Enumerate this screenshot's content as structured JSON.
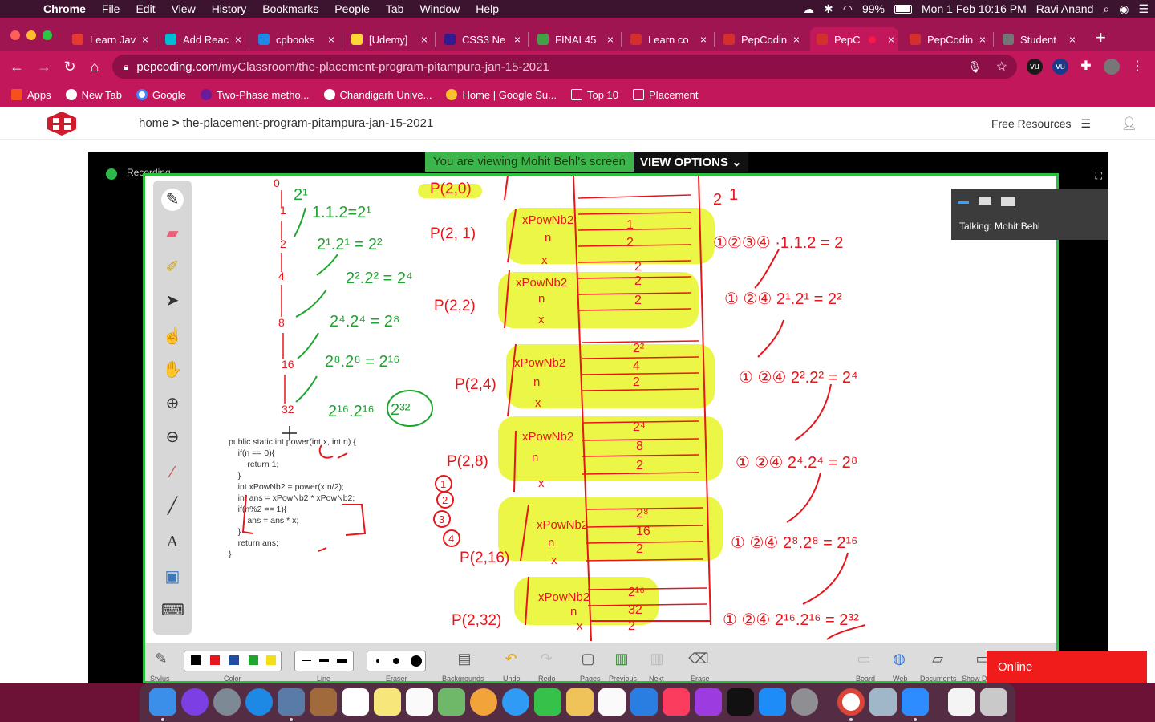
{
  "menubar": {
    "app": "Chrome",
    "items": [
      "File",
      "Edit",
      "View",
      "History",
      "Bookmarks",
      "People",
      "Tab",
      "Window",
      "Help"
    ],
    "battery": "99%",
    "datetime": "Mon 1 Feb  10:16 PM",
    "user": "Ravi Anand"
  },
  "tabs": [
    {
      "label": "Learn Jav",
      "color": "#e53935"
    },
    {
      "label": "Add Reac",
      "color": "#00bcd4"
    },
    {
      "label": "cpbooks",
      "color": "#1e88e5"
    },
    {
      "label": "[Udemy]",
      "color": "#fdd835"
    },
    {
      "label": "CSS3 Ne",
      "color": "#311b92"
    },
    {
      "label": "FINAL45",
      "color": "#43a047"
    },
    {
      "label": "Learn co",
      "color": "#d32f2f"
    },
    {
      "label": "PepCodin",
      "color": "#d32f2f"
    },
    {
      "label": "PepC",
      "color": "#d32f2f"
    },
    {
      "label": "PepCodin",
      "color": "#d32f2f"
    },
    {
      "label": "Student",
      "color": "#757575"
    }
  ],
  "omnibox": {
    "host": "pepcoding.com",
    "path": "/myClassroom/the-placement-program-pitampura-jan-15-2021"
  },
  "bookmarks": [
    "Apps",
    "New Tab",
    "Google",
    "Two-Phase metho...",
    "Chandigarh Unive...",
    "Home | Google Su...",
    "Top 10",
    "Placement"
  ],
  "site": {
    "crumb_home": "home",
    "crumb_page": "the-placement-program-pitampura-jan-15-2021",
    "free_resources": "Free Resources"
  },
  "video": {
    "recording_label": "Recording",
    "banner_text": "You are viewing Mohit Behl's screen",
    "view_options": "VIEW OPTIONS",
    "talking": "Talking:  Mohit Behl"
  },
  "code_lines": [
    "public static int power(int x, int n) {",
    "    if(n == 0){",
    "        return 1;",
    "    }",
    "    int xPowNb2 = power(x,n/2);",
    "    int ans = xPowNb2 * xPowNb2;",
    "    if(n%2 == 1){",
    "        ans = ans * x;",
    "    }",
    "    return ans;",
    "}"
  ],
  "bottom_labels": [
    "Stylus",
    "Color",
    "Line",
    "Eraser",
    "Backgrounds",
    "Undo",
    "Redo",
    "Pages",
    "Previous",
    "Next",
    "Erase",
    "Board",
    "Web",
    "Documents",
    "Show De"
  ],
  "online_label": "Online",
  "colors": {
    "accent": "#c2185b",
    "tabstrip": "#9e1552",
    "ink_red": "#e8151b",
    "ink_green": "#1fa52f",
    "highlight": "#e9f526",
    "frame_green": "#29c03a"
  }
}
